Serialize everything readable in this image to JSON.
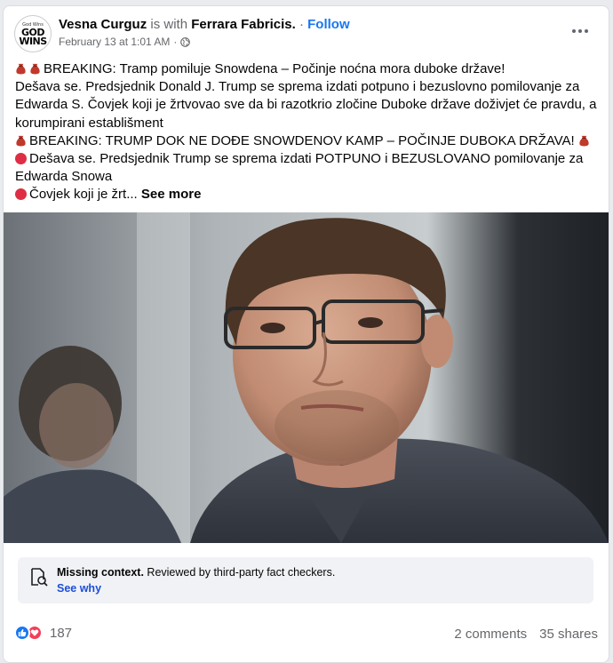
{
  "author": {
    "name": "Vesna Curguz",
    "with_text": "is with",
    "page": "Ferrara Fabricis.",
    "follow": "Follow",
    "separator": "·",
    "timestamp": "February 13 at 1:01 AM",
    "avatar_caption": "God Wins",
    "avatar_line1": "GOD",
    "avatar_line2": "WINS"
  },
  "post": {
    "line1": "BREAKING: Tramp pomiluje Snowdena – Počinje noćna mora duboke države!",
    "line2": "Dešava se. Predsjednik Donald J. Trump se sprema izdati potpuno i bezuslovno pomilovanje za Edwarda S. Čovjek koji je žrtvovao sve da bi razotkrio zločine Duboke države doživjet će pravdu, a korumpirani establišment",
    "line3": "BREAKING: TRUMP DOK NE DOĐE SNOWDENOV KAMP – POČINJE DUBOKA DRŽAVA!",
    "line4": "Dešava se. Predsjednik Trump se sprema izdati POTPUNO i BEZUSLOVANO pomilovanje za Edwarda Snowa",
    "line5": "Čovjek koji je žrt...",
    "see_more": "See more"
  },
  "fact_check": {
    "title": "Missing context.",
    "subtitle": "Reviewed by third-party fact checkers.",
    "link": "See why"
  },
  "footer": {
    "reaction_count": "187",
    "comments": "2 comments",
    "shares": "35 shares"
  },
  "colors": {
    "link_blue": "#1877f2",
    "like_blue": "#1877f2",
    "love_red": "#f33e58",
    "muted_text": "#65676b"
  },
  "icons": [
    "globe-icon",
    "more-options-icon",
    "money-bag-icon",
    "red-circle-icon",
    "fact-check-icon",
    "like-reaction-icon",
    "love-reaction-icon"
  ]
}
